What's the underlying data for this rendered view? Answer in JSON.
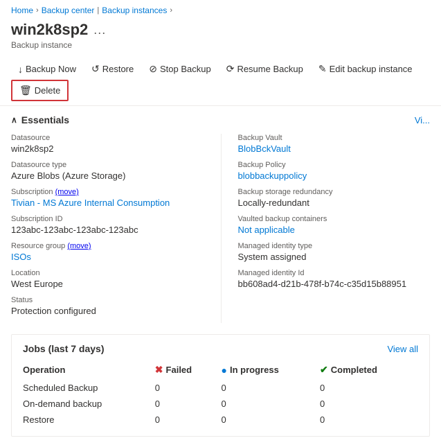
{
  "breadcrumb": {
    "home": "Home",
    "backup_center": "Backup center",
    "backup_instances": "Backup instances"
  },
  "page": {
    "title": "win2k8sp2",
    "subtitle": "Backup instance",
    "dots_label": "..."
  },
  "toolbar": {
    "backup_now": "Backup Now",
    "restore": "Restore",
    "stop_backup": "Stop Backup",
    "resume_backup": "Resume Backup",
    "edit_backup": "Edit backup instance",
    "delete": "Delete"
  },
  "essentials": {
    "title": "Essentials",
    "view_label": "Vi...",
    "left": {
      "datasource_label": "Datasource",
      "datasource_value": "win2k8sp2",
      "datasource_type_label": "Datasource type",
      "datasource_type_value": "Azure Blobs (Azure Storage)",
      "subscription_label": "Subscription",
      "subscription_move": "(move)",
      "subscription_value": "Tivian - MS Azure Internal Consumption",
      "subscription_id_label": "Subscription ID",
      "subscription_id_value": "123abc-123abc-123abc-123abc",
      "resource_group_label": "Resource group",
      "resource_group_move": "(move)",
      "resource_group_value": "ISOs",
      "location_label": "Location",
      "location_value": "West Europe",
      "status_label": "Status",
      "status_value": "Protection configured"
    },
    "right": {
      "backup_vault_label": "Backup Vault",
      "backup_vault_value": "BlobBckVault",
      "backup_policy_label": "Backup Policy",
      "backup_policy_value": "blobbackuppolicy",
      "backup_storage_label": "Backup storage redundancy",
      "backup_storage_value": "Locally-redundant",
      "vaulted_containers_label": "Vaulted backup containers",
      "vaulted_containers_value": "Not applicable",
      "managed_identity_label": "Managed identity type",
      "managed_identity_value": "System assigned",
      "managed_identity_id_label": "Managed identity Id",
      "managed_identity_id_value": "bb608ad4-d21b-478f-b74c-c35d15b88951"
    }
  },
  "jobs": {
    "title": "Jobs (last 7 days)",
    "view_all": "View all",
    "columns": {
      "operation": "Operation",
      "failed": "Failed",
      "in_progress": "In progress",
      "completed": "Completed"
    },
    "rows": [
      {
        "operation": "Scheduled Backup",
        "failed": "0",
        "in_progress": "0",
        "completed": "0"
      },
      {
        "operation": "On-demand backup",
        "failed": "0",
        "in_progress": "0",
        "completed": "0"
      },
      {
        "operation": "Restore",
        "failed": "0",
        "in_progress": "0",
        "completed": "0"
      }
    ]
  }
}
